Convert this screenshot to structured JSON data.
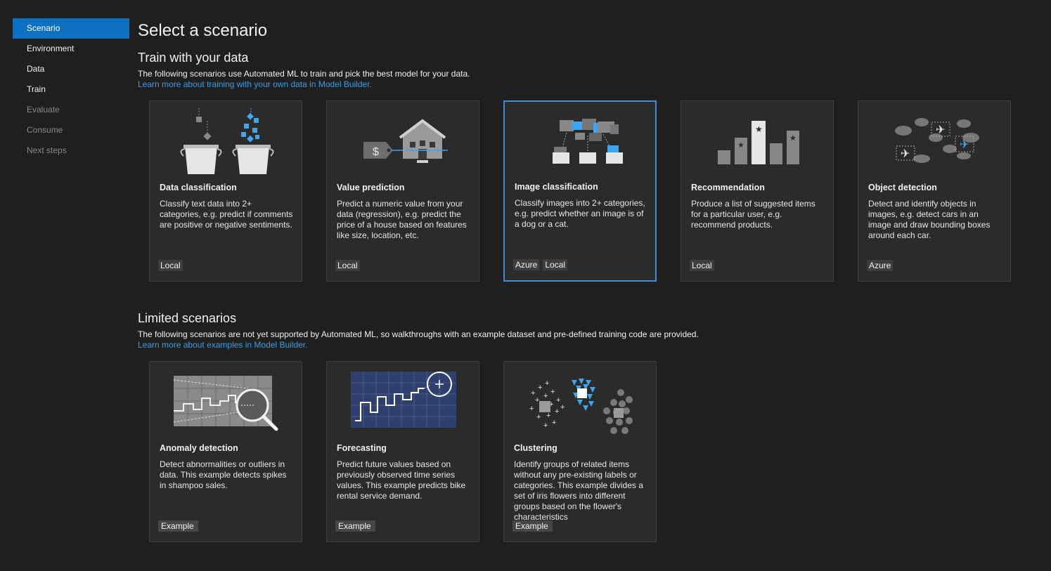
{
  "sidebar": {
    "items": [
      {
        "label": "Scenario",
        "state": "active"
      },
      {
        "label": "Environment",
        "state": "normal"
      },
      {
        "label": "Data",
        "state": "normal"
      },
      {
        "label": "Train",
        "state": "normal"
      },
      {
        "label": "Evaluate",
        "state": "disabled"
      },
      {
        "label": "Consume",
        "state": "disabled"
      },
      {
        "label": "Next steps",
        "state": "disabled"
      }
    ]
  },
  "page": {
    "title": "Select a scenario"
  },
  "train": {
    "heading": "Train with your data",
    "description": "The following scenarios use Automated ML to train and pick the best model for your data.",
    "link": "Learn more about training with your own data in Model Builder.",
    "cards": [
      {
        "title": "Data classification",
        "text": "Classify text data into 2+ categories, e.g. predict if comments are positive or negative sentiments.",
        "tags": [
          "Local"
        ],
        "icon": "buckets-icon"
      },
      {
        "title": "Value prediction",
        "text": "Predict a numeric value from your data (regression), e.g. predict the price of a house based on features like size, location, etc.",
        "tags": [
          "Local"
        ],
        "icon": "house-price-icon"
      },
      {
        "title": "Image classification",
        "text": "Classify images into 2+ categories, e.g. predict whether an image is of a dog or a cat.",
        "tags": [
          "Azure",
          "Local"
        ],
        "icon": "image-sort-icon"
      },
      {
        "title": "Recommendation",
        "text": "Produce a list of suggested items for a particular user, e.g. recommend products.",
        "tags": [
          "Local"
        ],
        "icon": "star-bars-icon"
      },
      {
        "title": "Object detection",
        "text": "Detect and identify objects in images, e.g. detect cars in an image and draw bounding boxes around each car.",
        "tags": [
          "Azure"
        ],
        "icon": "plane-detection-icon"
      }
    ]
  },
  "limited": {
    "heading": "Limited scenarios",
    "description": "The following scenarios are not yet supported by Automated ML, so walkthroughs with an example dataset and pre-defined training code are provided.",
    "link": "Learn more about examples in Model Builder.",
    "cards": [
      {
        "title": "Anomaly detection",
        "text": "Detect abnormalities or outliers in data. This example detects spikes in shampoo sales.",
        "tags": [
          "Example"
        ],
        "icon": "magnifier-chart-icon"
      },
      {
        "title": "Forecasting",
        "text": "Predict future values based on previously observed time series values. This example predicts bike rental service demand.",
        "tags": [
          "Example"
        ],
        "icon": "forecast-chart-icon"
      },
      {
        "title": "Clustering",
        "text": "Identify groups of related items without any pre-existing labels or categories. This example divides a set of iris flowers into different groups based on the flower's characteristics",
        "tags": [
          "Example"
        ],
        "icon": "clusters-icon"
      }
    ]
  },
  "colors": {
    "accent": "#0e70c0",
    "link": "#3b9ee8",
    "selected_border": "#3d8ddb",
    "icon_blue": "#3da6f2"
  }
}
